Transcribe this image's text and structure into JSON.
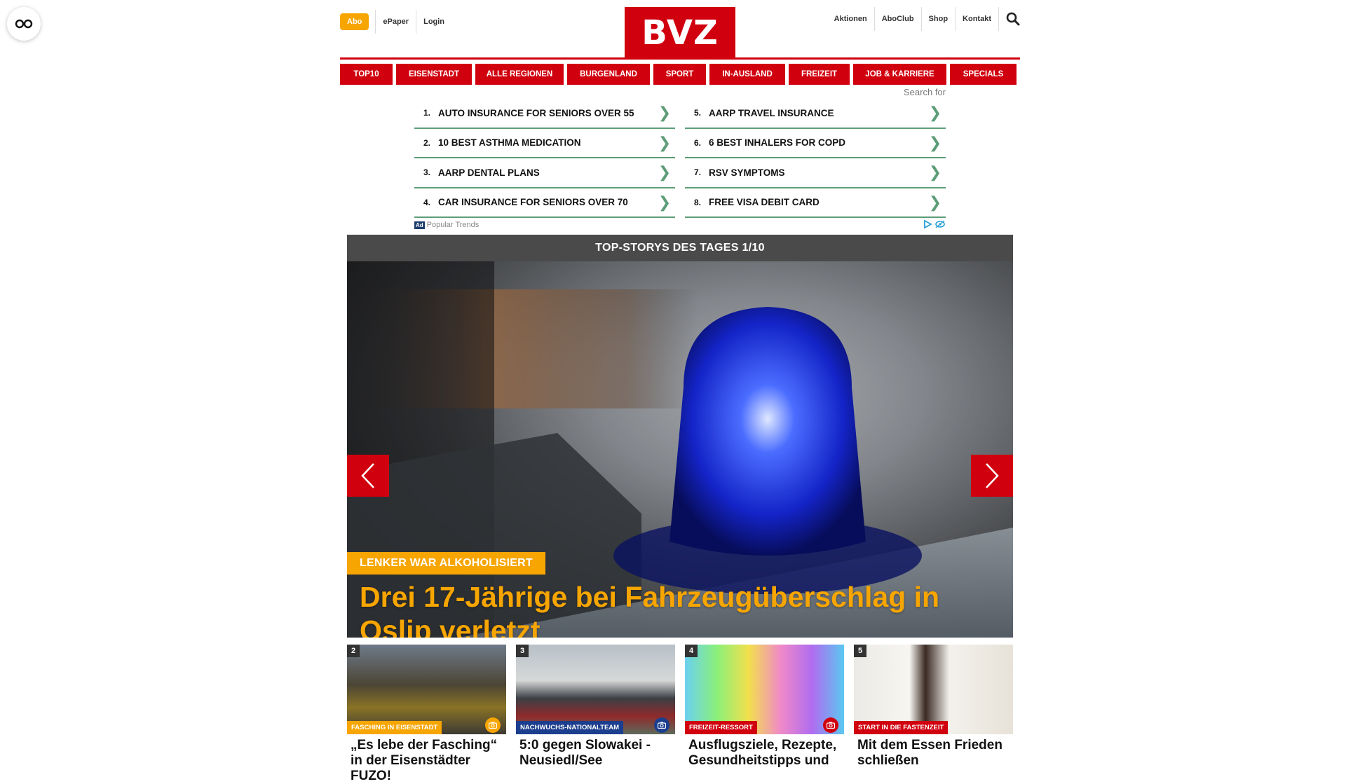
{
  "header": {
    "abo_label": "Abo",
    "left_links": [
      "ePaper",
      "Login"
    ],
    "logo_text": "BVZ",
    "right_links": [
      "Aktionen",
      "AboClub",
      "Shop",
      "Kontakt"
    ]
  },
  "nav": {
    "items": [
      "TOP10",
      "EISENSTADT",
      "ALLE REGIONEN",
      "BURGENLAND",
      "SPORT",
      "IN-AUSLAND",
      "FREIZEIT",
      "JOB & KARRIERE",
      "SPECIALS"
    ]
  },
  "ad": {
    "search_label": "Search for",
    "left": [
      {
        "num": "1.",
        "text": "AUTO INSURANCE FOR SENIORS OVER 55"
      },
      {
        "num": "2.",
        "text": "10 BEST ASTHMA MEDICATION"
      },
      {
        "num": "3.",
        "text": "AARP DENTAL PLANS"
      },
      {
        "num": "4.",
        "text": "CAR INSURANCE FOR SENIORS OVER 70"
      }
    ],
    "right": [
      {
        "num": "5.",
        "text": "AARP TRAVEL INSURANCE"
      },
      {
        "num": "6.",
        "text": "6 BEST INHALERS FOR COPD"
      },
      {
        "num": "7.",
        "text": "RSV SYMPTOMS"
      },
      {
        "num": "8.",
        "text": "FREE VISA DEBIT CARD"
      }
    ],
    "badge": "Ad",
    "footer_label": "Popular Trends",
    "arrow_glyph": "❯"
  },
  "hero": {
    "header": "TOP-STORYS DES TAGES 1/10",
    "kicker": "LENKER WAR ALKOHOLISIERT",
    "title": "Drei 17-Jährige bei Fahrzeugüberschlag in Oslip verletzt"
  },
  "cards": [
    {
      "num": "2",
      "tag": "FASCHING IN EISENSTADT",
      "tag_color": "#f7a500",
      "cam_color": "#f7a500",
      "title": "„Es lebe der Fasching“ in der Eisenstädter FUZO!"
    },
    {
      "num": "3",
      "tag": "NACHWUCHS-NATIONALTEAM",
      "tag_color": "#1c3e8e",
      "cam_color": "#1c3e8e",
      "title": "5:0 gegen Slowakei - Neusiedl/See"
    },
    {
      "num": "4",
      "tag": "FREIZEIT-RESSORT",
      "tag_color": "#d1000f",
      "cam_color": "#d1000f",
      "title": "Ausflugsziele, Rezepte, Gesundheitstipps und"
    },
    {
      "num": "5",
      "tag": "START IN DIE FASTENZEIT",
      "tag_color": "#d1000f",
      "cam_color": "",
      "title": "Mit dem Essen Frieden schließen"
    }
  ],
  "colors": {
    "brand_red": "#d1000f",
    "accent_orange": "#f7a500",
    "ad_green": "#5d9d78"
  }
}
